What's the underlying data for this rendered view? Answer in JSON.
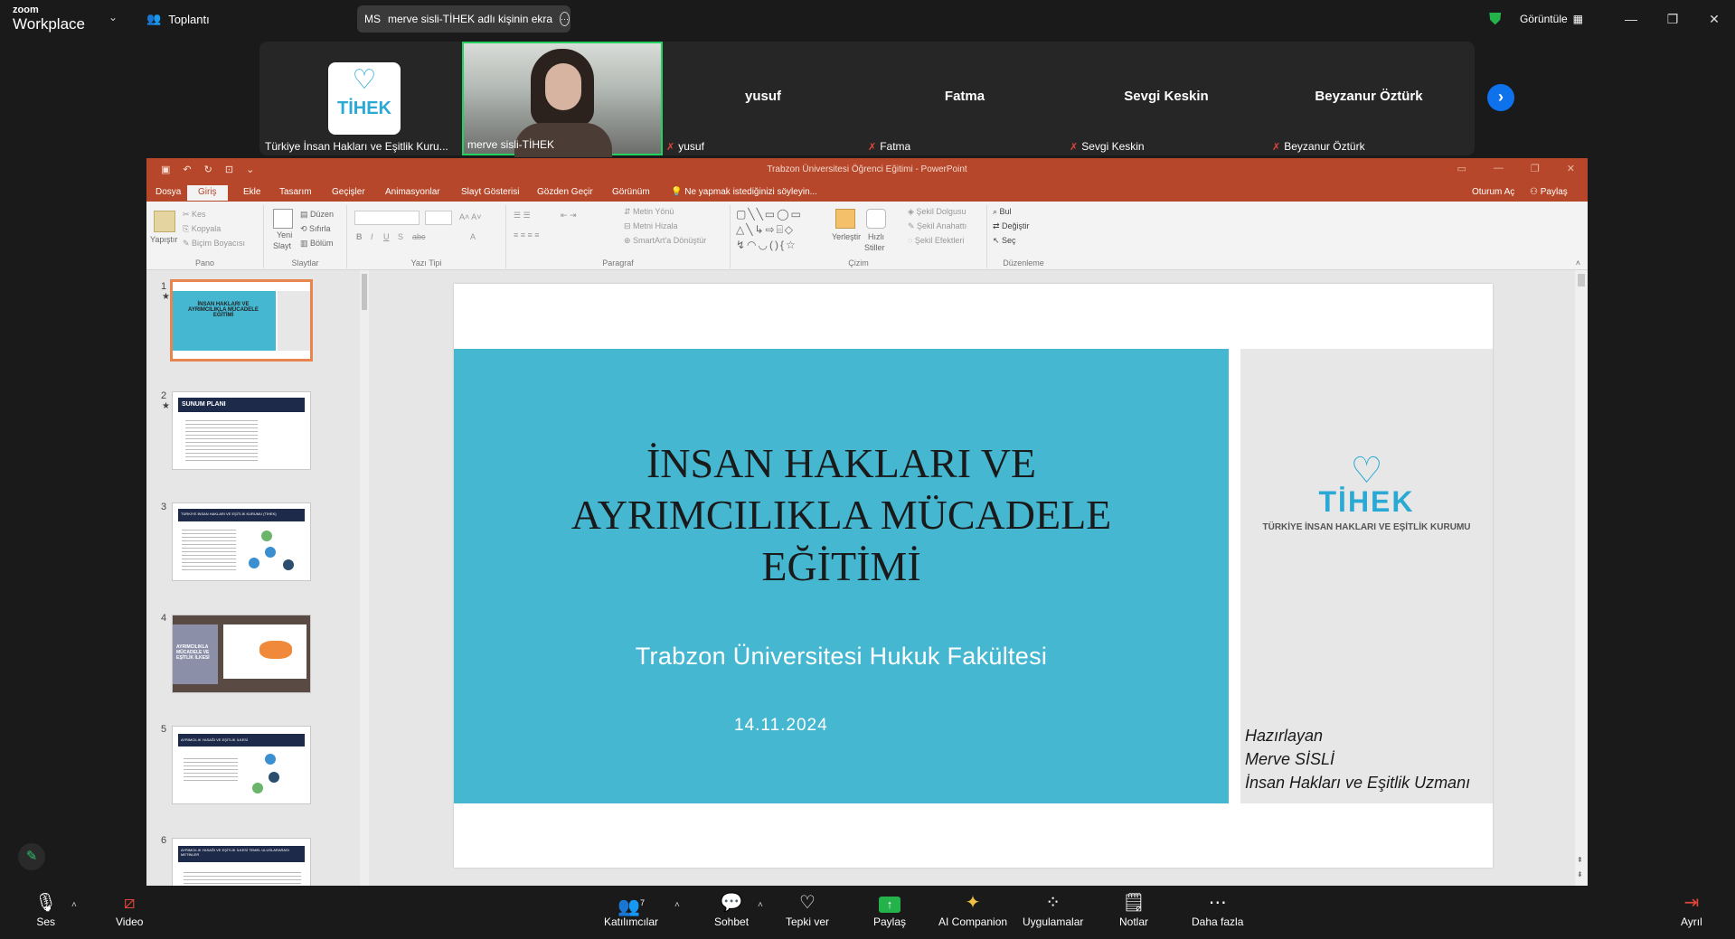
{
  "zoom": {
    "brand_top": "zoom",
    "brand_bottom": "Workplace",
    "meeting_label": "Toplantı",
    "share_badge": "MS",
    "share_text": "merve sisli-TİHEK adlı kişinin ekra",
    "view_label": "Görüntüle"
  },
  "participants": [
    {
      "name": "Türkiye İnsan Hakları ve Eşitlik Kuru...",
      "kind": "logo",
      "logo_text": "TİHEK"
    },
    {
      "name": "merve sisli-TİHEK",
      "kind": "video"
    },
    {
      "name": "yusuf",
      "kind": "name",
      "muted": true
    },
    {
      "name": "Fatma",
      "kind": "name",
      "muted": true
    },
    {
      "name": "Sevgi Keskin",
      "kind": "name",
      "muted": true
    },
    {
      "name": "Beyzanur Öztürk",
      "kind": "name",
      "muted": true
    }
  ],
  "ppt": {
    "window_title": "Trabzon Üniversitesi Öğrenci Eğitimi - PowerPoint",
    "tabs": [
      "Dosya",
      "Giriş",
      "Ekle",
      "Tasarım",
      "Geçişler",
      "Animasyonlar",
      "Slayt Gösterisi",
      "Gözden Geçir",
      "Görünüm"
    ],
    "tell_me": "Ne yapmak istediğinizi söyleyin...",
    "signin": "Oturum Aç",
    "share": "Paylaş",
    "ribbon": {
      "pano": {
        "label": "Pano",
        "paste": "Yapıştır",
        "cut": "Kes",
        "copy": "Kopyala",
        "painter": "Biçim Boyacısı"
      },
      "slaytlar": {
        "label": "Slaytlar",
        "new": "Yeni",
        "new2": "Slayt",
        "layout": "Düzen",
        "reset": "Sıfırla",
        "section": "Bölüm"
      },
      "yazi": {
        "label": "Yazı Tipi"
      },
      "paragraf": {
        "label": "Paragraf",
        "dir": "Metin Yönü",
        "align": "Metni Hizala",
        "smart": "SmartArt'a Dönüştür"
      },
      "cizim": {
        "label": "Çizim",
        "arrange": "Yerleştir",
        "quick": "Hızlı",
        "quick2": "Stiller",
        "fill": "Şekil Dolgusu",
        "outline": "Şekil Anahattı",
        "effects": "Şekil Efektleri"
      },
      "duzenleme": {
        "label": "Düzenleme",
        "find": "Bul",
        "replace": "Değiştir",
        "select": "Seç"
      }
    },
    "thumbnails": [
      {
        "num": "1",
        "star": "★",
        "title": "İNSAN HAKLARI VE AYRIMCILIKLA MÜCADELE EĞİTİMİ"
      },
      {
        "num": "2",
        "star": "★",
        "title": "SUNUM PLANI"
      },
      {
        "num": "3",
        "star": "",
        "title": "TÜRKİYE İNSAN HAKLARI VE EŞİTLİK KURUMU (TİHEK)"
      },
      {
        "num": "4",
        "star": "",
        "title": "AYRIMCILIKLA MÜCADELE VE EŞİTLİK İLKESİ"
      },
      {
        "num": "5",
        "star": "",
        "title": "AYRIMCILIK YASAĞI VE EŞİTLİK İLKESİ"
      },
      {
        "num": "6",
        "star": "",
        "title": "AYRIMCILIK YASAĞI VE EŞİTLİK İLKESİ TEMEL ULUSLARARASI METİNLER"
      }
    ],
    "slide": {
      "title_lines": [
        "İNSAN HAKLARI VE",
        "AYRIMCILIKLA MÜCADELE",
        "EĞİTİMİ"
      ],
      "subtitle": "Trabzon Üniversitesi Hukuk Fakültesi",
      "date": "14.11.2024",
      "logo_name": "TİHEK",
      "logo_sub": "TÜRKİYE İNSAN HAKLARI VE EŞİTLİK KURUMU",
      "prepared": [
        "Hazırlayan",
        "Merve SİSLİ",
        "İnsan Hakları ve Eşitlik Uzmanı"
      ]
    }
  },
  "controls": {
    "audio": "Ses",
    "video": "Video",
    "participants": "Katılımcılar",
    "participants_count": "7",
    "chat": "Sohbet",
    "react": "Tepki ver",
    "share": "Paylaş",
    "ai": "AI Companion",
    "apps": "Uygulamalar",
    "notes": "Notlar",
    "more": "Daha fazla",
    "leave": "Ayrıl"
  },
  "colors": {
    "ppt_accent": "#b7472a",
    "slide_band": "#45b7d1",
    "zoom_blue": "#0e72ed",
    "share_green": "#23b34a",
    "leave_red": "#e0463a"
  }
}
